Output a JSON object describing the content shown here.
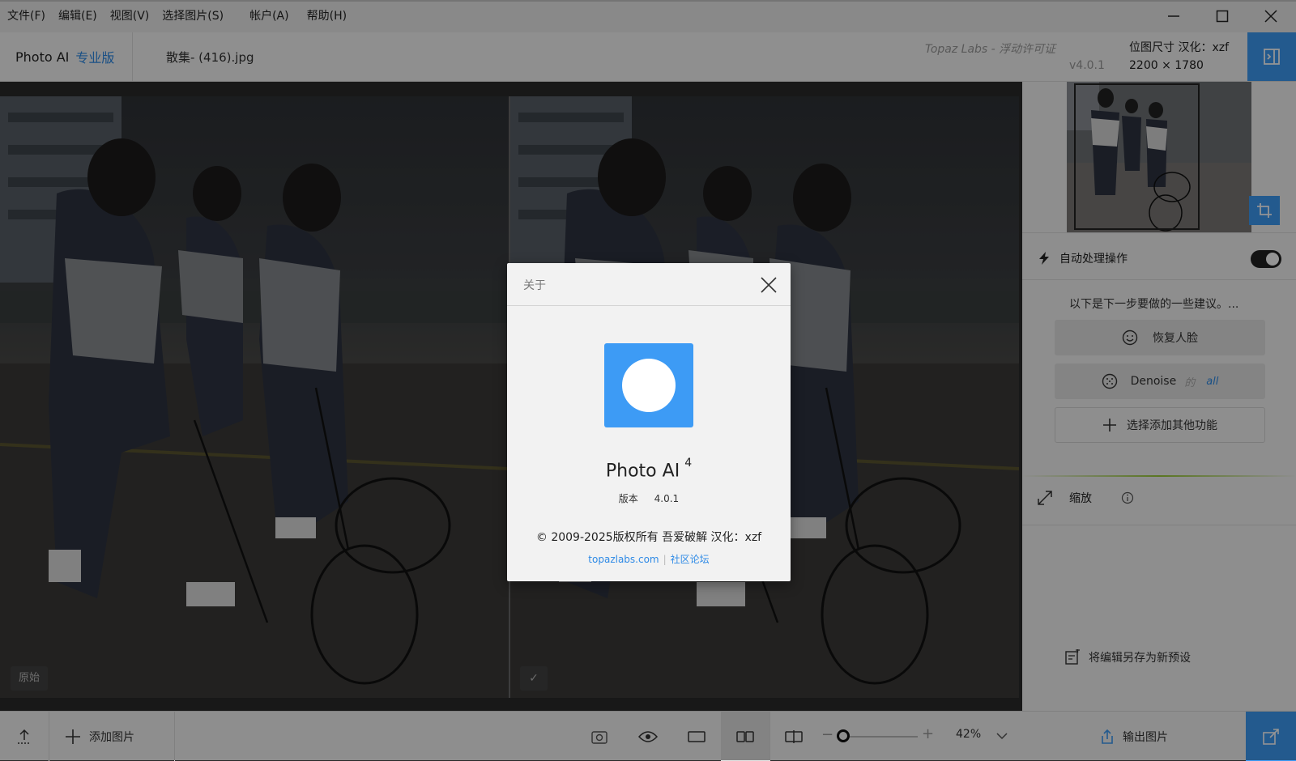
{
  "menu": [
    "文件(F)",
    "编辑(E)",
    "视图(V)",
    "选择图片(S)",
    "帐户(A)",
    "帮助(H)"
  ],
  "header": {
    "app_name": "Photo AI",
    "edition": "专业版",
    "filename": "散集- (416).jpg",
    "license": "Topaz Labs - 浮动许可证",
    "version": "v4.0.1",
    "size_label": "位图尺寸 汉化：xzf",
    "size_value": "2200 × 1780"
  },
  "canvas": {
    "left_tag": "原始",
    "right_tag": "✓"
  },
  "panel": {
    "autopilot_label": "自动处理操作",
    "autopilot_on": true,
    "suggest_text": "以下是下一步要做的一些建议。...",
    "buttons": {
      "face": "恢复人脸",
      "denoise": "Denoise",
      "denoise_sep": "的",
      "denoise_scope": "all",
      "add": "选择添加其他功能"
    },
    "zoom_label": "缩放",
    "save_preset": "将编辑另存为新预设"
  },
  "bottom": {
    "add_images": "添加图片",
    "zoom_percent": "42%",
    "zoom_level": 0.42,
    "export": "输出图片"
  },
  "about": {
    "title": "关于",
    "app_name": "Photo AI",
    "major": "4",
    "version_label": "版本",
    "version": "4.0.1",
    "copyright": "© 2009-2025版权所有  吾爱破解  汉化：xzf",
    "link_site": "topazlabs.com",
    "link_forum": "社区论坛"
  },
  "colors": {
    "accent": "#3d9bf5",
    "link": "#2e8ae6"
  }
}
